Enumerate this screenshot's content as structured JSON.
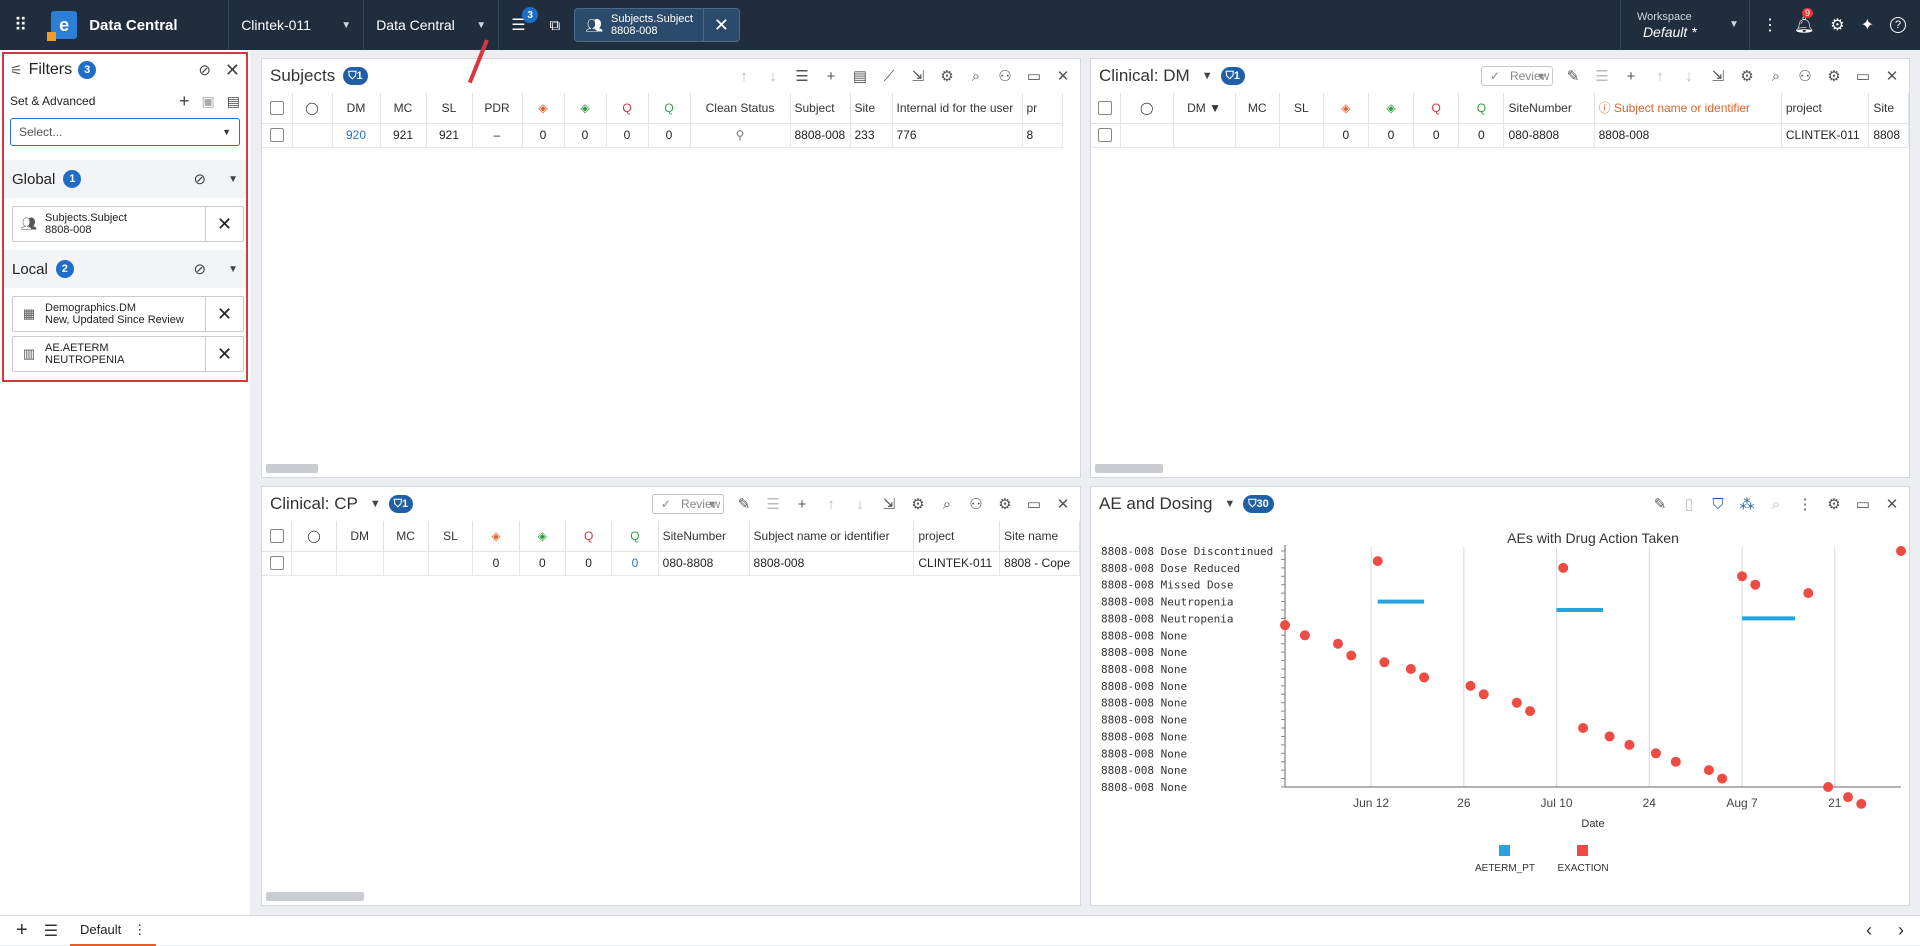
{
  "topbar": {
    "app_title": "Data Central",
    "study": "Clintek-011",
    "module": "Data Central",
    "filter_count": "3",
    "active_filter": {
      "line1": "Subjects.Subject",
      "line2": "8808-008"
    },
    "workspace_label": "Workspace",
    "workspace_value": "Default",
    "workspace_mark": "*",
    "notification_count": "9"
  },
  "filters": {
    "title": "Filters",
    "count": "3",
    "set_advanced": "Set & Advanced",
    "select_placeholder": "Select...",
    "global": {
      "label": "Global",
      "count": "1",
      "items": [
        {
          "line1": "Subjects.Subject",
          "line2": "8808-008"
        }
      ]
    },
    "local": {
      "label": "Local",
      "count": "2",
      "items": [
        {
          "line1": "Demographics.DM",
          "line2": "New, Updated Since Review"
        },
        {
          "line1": "AE.AETERM",
          "line2": "NEUTROPENIA"
        }
      ]
    }
  },
  "subjects": {
    "title": "Subjects",
    "badge": "1",
    "columns": [
      "DM",
      "MC",
      "SL",
      "PDR",
      "Clean Status",
      "Subject",
      "Site",
      "Internal id for the user",
      "pr"
    ],
    "row": {
      "dm": "920",
      "mc": "921",
      "sl": "921",
      "pdr": "–",
      "t1": "0",
      "t2": "0",
      "q1": "0",
      "q2": "0",
      "subject": "8808-008",
      "site": "233",
      "internal": "776",
      "pr": "8"
    }
  },
  "dm": {
    "title": "Clinical: DM",
    "badge": "1",
    "review": "Review",
    "columns": [
      "DM",
      "MC",
      "SL",
      "SiteNumber",
      "Subject name or identifier",
      "project",
      "Site"
    ],
    "row": {
      "t1": "0",
      "t2": "0",
      "q1": "0",
      "q2": "0",
      "sitenumber": "080-8808",
      "subject": "8808-008",
      "project": "CLINTEK-011",
      "site": "8808"
    }
  },
  "cp": {
    "title": "Clinical: CP",
    "badge": "1",
    "review": "Review",
    "columns": [
      "DM",
      "MC",
      "SL",
      "SiteNumber",
      "Subject name or identifier",
      "project",
      "Site name"
    ],
    "row": {
      "t1": "0",
      "t2": "0",
      "q1": "0",
      "q2": "0",
      "sitenumber": "080-8808",
      "subject": "8808-008",
      "project": "CLINTEK-011",
      "sitename": "8808 - Cope"
    }
  },
  "ae": {
    "title": "AE and Dosing",
    "badge": "30"
  },
  "chart_data": {
    "type": "scatter",
    "title": "AEs with Drug Action Taken",
    "xlabel": "Date",
    "ylabel": "",
    "x_ticks": [
      "Jun 12",
      "26",
      "Jul 10",
      "24",
      "Aug 7",
      "21"
    ],
    "x_range": [
      "2024-06-03",
      "2024-08-28"
    ],
    "categories": [
      "8808-008 Dose Discontinued",
      "8808-008 Dose Reduced",
      "8808-008 Missed Dose",
      "8808-008 Neutropenia",
      "8808-008 Neutropenia",
      "8808-008 None",
      "8808-008 None",
      "8808-008 None",
      "8808-008 None",
      "8808-008 None",
      "8808-008 None",
      "8808-008 None",
      "8808-008 None",
      "8808-008 None",
      "8808-008 None"
    ],
    "legend": [
      {
        "name": "AETERM_PT",
        "color": "#29a3e0"
      },
      {
        "name": "EXACTION",
        "color": "#ee4b43"
      }
    ],
    "series": [
      {
        "name": "AETERM_PT",
        "color": "#29a3e0",
        "segments": [
          {
            "start": "2024-06-13",
            "end": "2024-06-20",
            "y": 3
          },
          {
            "start": "2024-07-10",
            "end": "2024-07-17",
            "y": 3.5
          },
          {
            "start": "2024-08-07",
            "end": "2024-08-15",
            "y": 4
          }
        ]
      },
      {
        "name": "EXACTION",
        "color": "#ee4b43",
        "points": [
          {
            "x": "2024-05-30",
            "y": 4.4
          },
          {
            "x": "2024-06-02",
            "y": 5
          },
          {
            "x": "2024-06-07",
            "y": 5.5
          },
          {
            "x": "2024-06-09",
            "y": 6.2
          },
          {
            "x": "2024-06-13",
            "y": 0.6
          },
          {
            "x": "2024-06-14",
            "y": 6.6
          },
          {
            "x": "2024-06-18",
            "y": 7
          },
          {
            "x": "2024-06-20",
            "y": 7.5
          },
          {
            "x": "2024-06-27",
            "y": 8
          },
          {
            "x": "2024-06-29",
            "y": 8.5
          },
          {
            "x": "2024-07-04",
            "y": 9
          },
          {
            "x": "2024-07-06",
            "y": 9.5
          },
          {
            "x": "2024-07-11",
            "y": 1
          },
          {
            "x": "2024-07-14",
            "y": 10.5
          },
          {
            "x": "2024-07-18",
            "y": 11
          },
          {
            "x": "2024-07-21",
            "y": 11.5
          },
          {
            "x": "2024-07-25",
            "y": 12
          },
          {
            "x": "2024-07-28",
            "y": 12.5
          },
          {
            "x": "2024-08-02",
            "y": 13
          },
          {
            "x": "2024-08-04",
            "y": 13.5
          },
          {
            "x": "2024-08-07",
            "y": 1.5
          },
          {
            "x": "2024-08-09",
            "y": 2
          },
          {
            "x": "2024-08-17",
            "y": 2.5
          },
          {
            "x": "2024-08-20",
            "y": 14
          },
          {
            "x": "2024-08-23",
            "y": 14.6
          },
          {
            "x": "2024-08-25",
            "y": 15
          },
          {
            "x": "2024-08-31",
            "y": 0
          }
        ]
      }
    ]
  },
  "bottom": {
    "tab": "Default"
  }
}
